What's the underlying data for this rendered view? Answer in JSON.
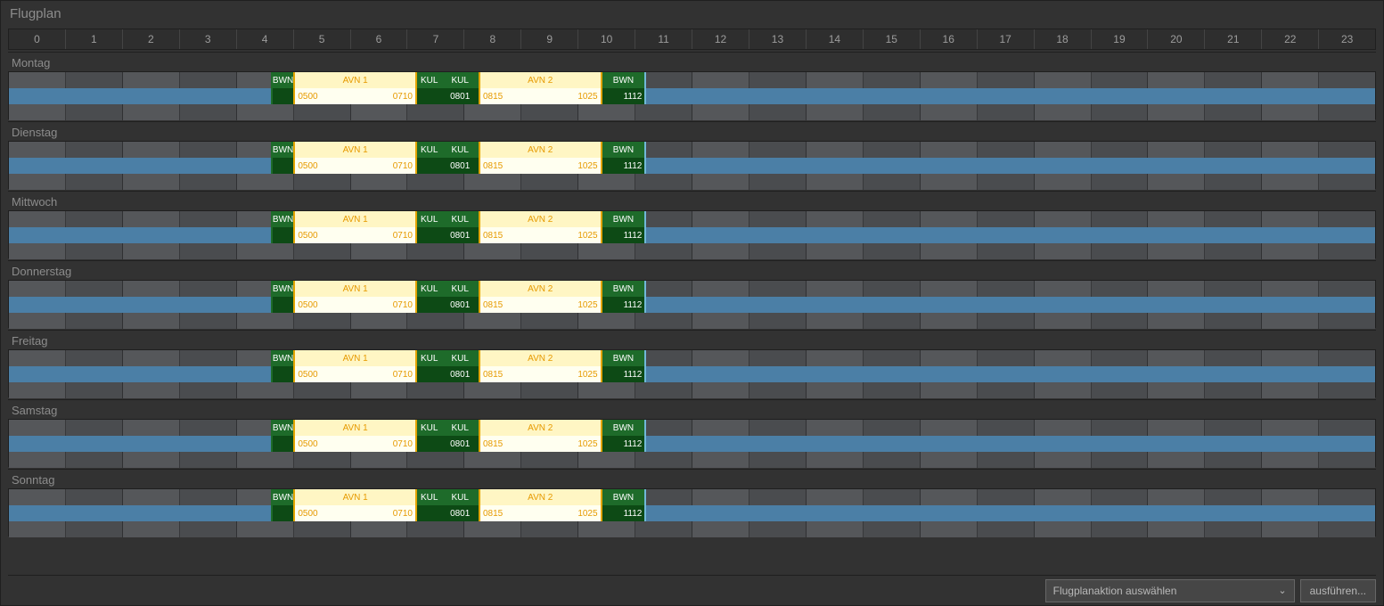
{
  "title": "Flugplan",
  "hours": [
    "0",
    "1",
    "2",
    "3",
    "4",
    "5",
    "6",
    "7",
    "8",
    "9",
    "10",
    "11",
    "12",
    "13",
    "14",
    "15",
    "16",
    "17",
    "18",
    "19",
    "20",
    "21",
    "22",
    "23"
  ],
  "days": [
    "Montag",
    "Dienstag",
    "Mittwoch",
    "Donnerstag",
    "Freitag",
    "Samstag",
    "Sonntag"
  ],
  "stripe": {
    "start_h": 0.0,
    "end_h": 24.0
  },
  "row_template": {
    "segments": [
      {
        "kind": "ground",
        "label": "BWN",
        "start_h": 4.6,
        "end_h": 5.0,
        "bot_right": "",
        "cls": "bwn"
      },
      {
        "kind": "flight",
        "label": "AVN 1",
        "start_h": 5.0,
        "end_h": 7.17,
        "bot_left": "0500",
        "bot_right": "0710"
      },
      {
        "kind": "ground",
        "label": "KUL",
        "start_h": 7.17,
        "end_h": 7.6,
        "bot_right": ""
      },
      {
        "kind": "ground",
        "label": "KUL",
        "start_h": 7.6,
        "end_h": 8.25,
        "bot_center": "0801"
      },
      {
        "kind": "flight",
        "label": "AVN 2",
        "start_h": 8.25,
        "end_h": 10.42,
        "bot_left": "0815",
        "bot_right": "1025"
      },
      {
        "kind": "ground",
        "label": "BWN",
        "start_h": 10.42,
        "end_h": 11.2,
        "bot_right": "1112",
        "cls": "bwne"
      }
    ]
  },
  "footer": {
    "select_placeholder": "Flugplanaktion auswählen",
    "button_label": "ausführen..."
  },
  "colors": {
    "flight_bg_top": "#fff6c4",
    "flight_bg_bot": "#fffff0",
    "flight_text": "#e69a00",
    "ground_bg_top": "#1e6b2a",
    "ground_bg_bot": "#0d4a15",
    "stripe": "#4b7fa6"
  },
  "chart_data": {
    "type": "table",
    "title": "Flugplan",
    "x_unit": "hour_of_day",
    "x_range": [
      0,
      24
    ],
    "days": [
      "Montag",
      "Dienstag",
      "Mittwoch",
      "Donnerstag",
      "Freitag",
      "Samstag",
      "Sonntag"
    ],
    "per_day_segments": [
      {
        "type": "ground",
        "code": "BWN",
        "start": "04:36",
        "end": "05:00"
      },
      {
        "type": "flight",
        "code": "AVN 1",
        "start": "05:00",
        "end": "07:10"
      },
      {
        "type": "ground",
        "code": "KUL",
        "start": "07:10",
        "end": "07:36"
      },
      {
        "type": "ground",
        "code": "KUL",
        "start": "07:36",
        "end": "08:15",
        "note": "0801"
      },
      {
        "type": "flight",
        "code": "AVN 2",
        "start": "08:15",
        "end": "10:25"
      },
      {
        "type": "ground",
        "code": "BWN",
        "start": "10:25",
        "end": "11:12"
      }
    ],
    "availability_stripe": {
      "start": "00:00",
      "end": "24:00"
    }
  }
}
